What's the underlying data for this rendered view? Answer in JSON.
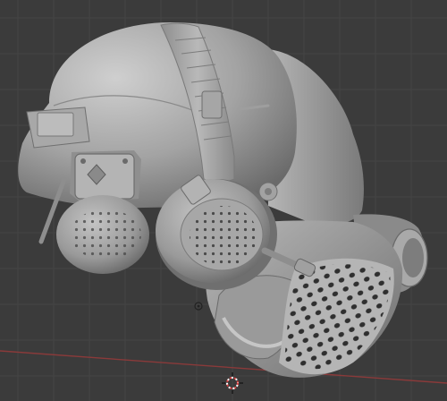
{
  "viewport": {
    "background": "#3b3b3b",
    "grid_color": "#444444",
    "x_axis_color": "#8a3a3a",
    "model_base_color": "#9c9c9c",
    "model_shadow_color": "#5a5a5a",
    "model_highlight_color": "#c8c8c8"
  },
  "scene": {
    "object": "helmet-with-earcups-and-respirator-mask",
    "shading": "solid-matcap-gray",
    "markers": [
      "origin-marker",
      "3d-cursor"
    ]
  }
}
